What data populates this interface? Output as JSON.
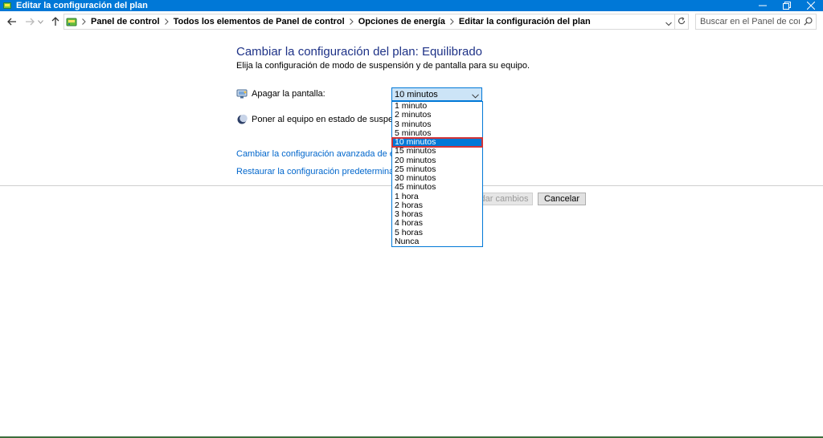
{
  "window": {
    "title": "Editar la configuración del plan",
    "icon": "control-panel-icon"
  },
  "navigation": {
    "breadcrumbs": [
      "Panel de control",
      "Todos los elementos de Panel de control",
      "Opciones de energía",
      "Editar la configuración del plan"
    ],
    "search_placeholder": "Buscar en el Panel de control"
  },
  "main": {
    "title": "Cambiar la configuración del plan: Equilibrado",
    "subtitle": "Elija la configuración de modo de suspensión y de pantalla para su equipo.",
    "display_off": {
      "label": "Apagar la pantalla:",
      "value": "10 minutos",
      "icon": "monitor-icon"
    },
    "sleep": {
      "label": "Poner al equipo en estado de suspensión:",
      "icon": "moon-icon"
    },
    "links": {
      "advanced": "Cambiar la configuración avanzada de energía",
      "restore": "Restaurar la configuración predeterminada de est"
    },
    "buttons": {
      "save": "dar cambios",
      "cancel": "Cancelar"
    }
  },
  "dropdown": {
    "options": [
      "1 minuto",
      "2 minutos",
      "3 minutos",
      "5 minutos",
      "10 minutos",
      "15 minutos",
      "20 minutos",
      "25 minutos",
      "30 minutos",
      "45 minutos",
      "1 hora",
      "2 horas",
      "3 horas",
      "4 horas",
      "5 horas",
      "Nunca"
    ],
    "selected": "10 minutos"
  },
  "colors": {
    "titlebar": "#0078d7",
    "heading": "#1e3287",
    "link": "#0066cc",
    "selection": "#0078d7",
    "highlight_outline": "#d13438"
  }
}
